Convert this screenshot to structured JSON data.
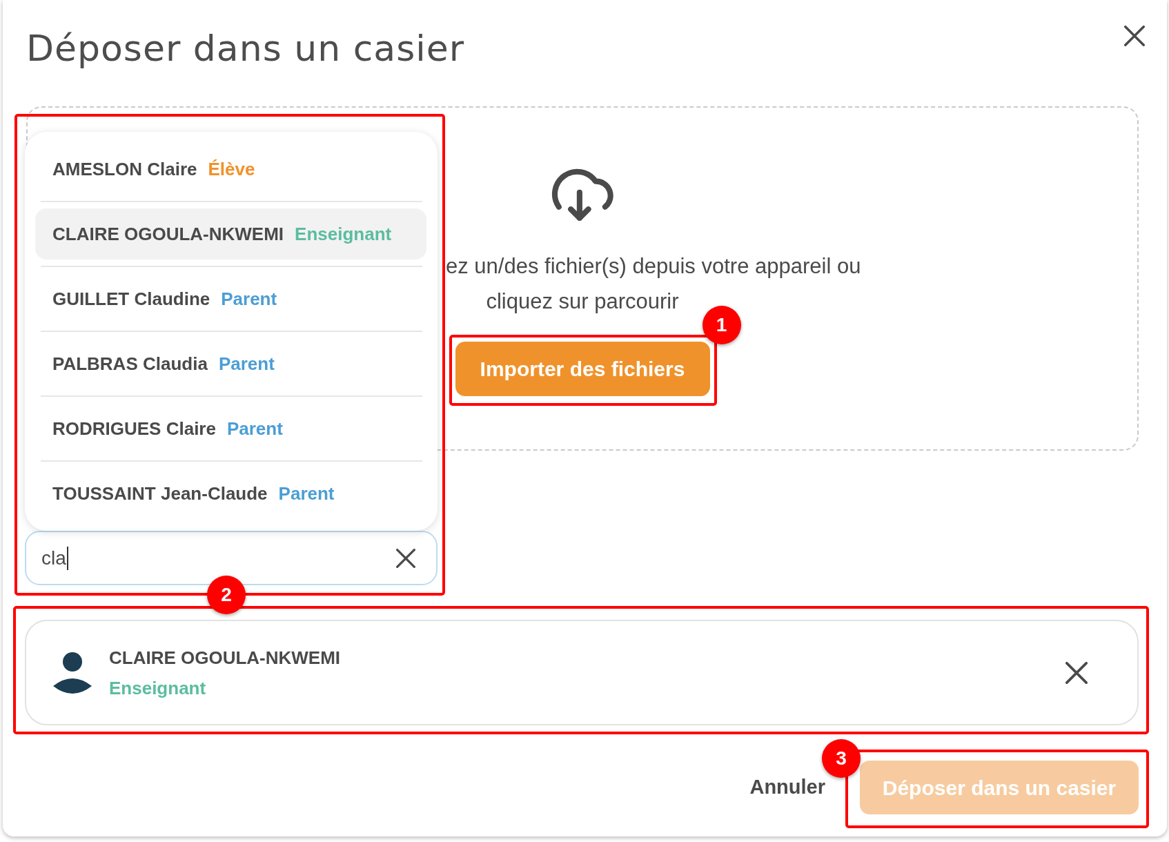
{
  "dialog": {
    "title": "Déposer dans un casier"
  },
  "drop_zone": {
    "lines": [
      "ez un/des fichier(s) depuis votre appareil ou",
      "cliquez sur parcourir"
    ],
    "import_button": {
      "label": "Importer des fichiers",
      "highlighted": true,
      "callout": "1"
    }
  },
  "recipient_search": {
    "value": "cla",
    "focused": true,
    "highlighted": true,
    "callout": "2",
    "results": [
      {
        "name": "AMESLON Claire",
        "role": "Élève",
        "color": "#f0922b",
        "selected": false
      },
      {
        "name": "CLAIRE OGOULA-NKWEMI",
        "role": "Enseignant",
        "color": "#5bbd9f",
        "selected": true
      },
      {
        "name": "GUILLET Claudine",
        "role": "Parent",
        "color": "#4b9ed5",
        "selected": false
      },
      {
        "name": "PALBRAS Claudia",
        "role": "Parent",
        "color": "#4b9ed5",
        "selected": false
      },
      {
        "name": "RODRIGUES Claire",
        "role": "Parent",
        "color": "#4b9ed5",
        "selected": false
      },
      {
        "name": "TOUSSAINT Jean-Claude",
        "role": "Parent",
        "color": "#4b9ed5",
        "selected": false
      }
    ]
  },
  "selected_recipient": {
    "name": "CLAIRE OGOULA-NKWEMI",
    "role": "Enseignant",
    "color": "#5bbd9f",
    "highlighted": true
  },
  "footer": {
    "cancel_button": {
      "label": "Annuler"
    },
    "submit_button": {
      "label": "Déposer dans un casier",
      "disabled": true,
      "highlighted": true,
      "callout": "3"
    }
  }
}
